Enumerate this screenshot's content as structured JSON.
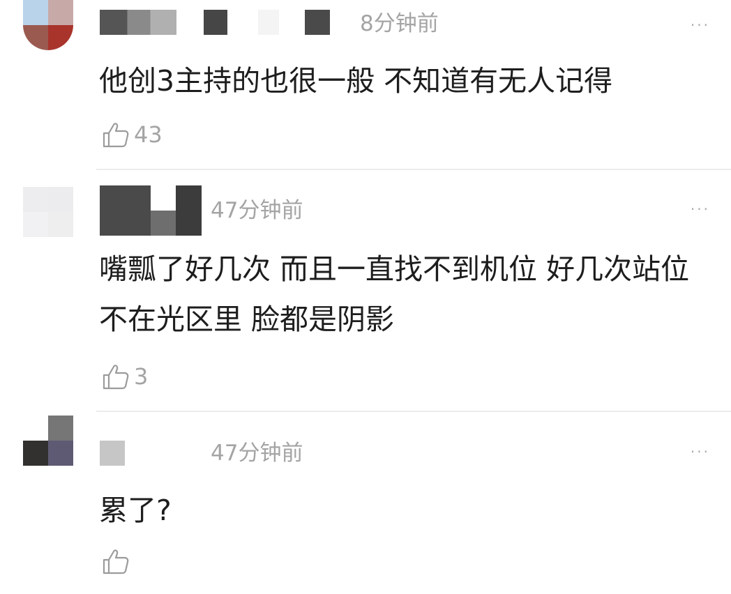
{
  "comments": [
    {
      "time": "8分钟前",
      "text": "他创3主持的也很一般 不知道有无人记得",
      "likes": "43",
      "avatar_colors": [
        "#b9d3ea",
        "#c7a9a8",
        "#9b5a50",
        "#a8342c"
      ],
      "more": "···"
    },
    {
      "time": "47分钟前",
      "text": "嘴瓢了好几次 而且一直找不到机位 好几次站位不在光区里 脸都是阴影",
      "likes": "3",
      "avatar_colors": [
        "#ededf0",
        "#ececee",
        "#f1f1f3",
        "#eeeeef"
      ],
      "more": "···"
    },
    {
      "time": "47分钟前",
      "text": "累了?",
      "likes": "",
      "avatar_colors": [
        "#ffffff",
        "#767676",
        "#323130",
        "#5f5a73"
      ],
      "more": "···"
    }
  ]
}
